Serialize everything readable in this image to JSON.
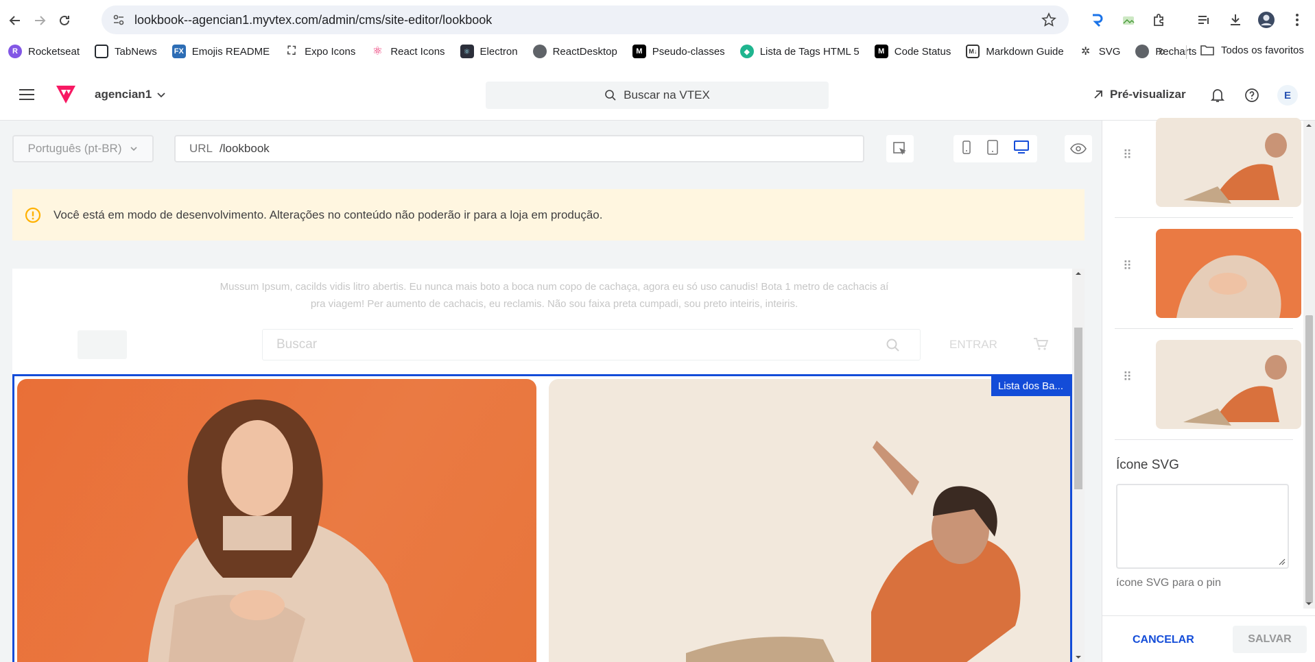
{
  "browser": {
    "url": "lookbook--agencian1.myvtex.com/admin/cms/site-editor/lookbook",
    "bookmarks": [
      {
        "label": "Rocketseat",
        "icon": "rocketseat-icon",
        "color": "#8257e5"
      },
      {
        "label": "TabNews",
        "icon": "tabnews-icon",
        "color": "#24292f"
      },
      {
        "label": "Emojis README",
        "icon": "fx-icon",
        "color": "#2d6db5"
      },
      {
        "label": "Expo Icons",
        "icon": "expo-icon",
        "color": "#444444"
      },
      {
        "label": "React Icons",
        "icon": "react-icon",
        "color": "#e91e63"
      },
      {
        "label": "Electron",
        "icon": "electron-icon",
        "color": "#2b2e3a"
      },
      {
        "label": "ReactDesktop",
        "icon": "globe-icon",
        "color": "#5f6368"
      },
      {
        "label": "Pseudo-classes",
        "icon": "mdn-icon",
        "color": "#000000"
      },
      {
        "label": "Lista de Tags HTML 5",
        "icon": "hex-icon",
        "color": "#1fb58f"
      },
      {
        "label": "Code Status",
        "icon": "mdn-icon",
        "color": "#000000"
      },
      {
        "label": "Markdown Guide",
        "icon": "markdown-icon",
        "color": "#333333"
      },
      {
        "label": "SVG",
        "icon": "svg-icon",
        "color": "#333333"
      },
      {
        "label": "Recharts",
        "icon": "globe-icon",
        "color": "#5f6368"
      }
    ],
    "all_bookmarks": "Todos os favoritos"
  },
  "header": {
    "account": "agencian1",
    "search_placeholder": "Buscar na VTEX",
    "preview": "Pré-visualizar",
    "avatar": "E"
  },
  "editor": {
    "language": "Português (pt-BR)",
    "url_label": "URL",
    "url_value": "/lookbook",
    "warning": "Você está em modo de desenvolvimento. Alterações no conteúdo não poderão ir para a loja em produção."
  },
  "preview_frame": {
    "lorem": "Mussum Ipsum, cacilds vidis litro abertis. Eu nunca mais boto a boca num copo de cachaça, agora eu só uso canudis! Bota 1 metro de cachacis aí pra viagem! Per aumento de cachacis, eu reclamis. Não sou faixa preta cumpadi, sou preto inteiris, inteiris.",
    "search_placeholder": "Buscar",
    "login": "ENTRAR",
    "selected_block_tag": "Lista dos Ba..."
  },
  "sidebar": {
    "svg_label": "Ícone SVG",
    "svg_help": "ícone SVG para o pin",
    "cancel": "CANCELAR",
    "save": "SALVAR"
  },
  "colors": {
    "accent": "#134cd8",
    "vtex_pink": "#f71963",
    "warning_bg": "#fff6e0",
    "warning_icon": "#ffb100"
  }
}
